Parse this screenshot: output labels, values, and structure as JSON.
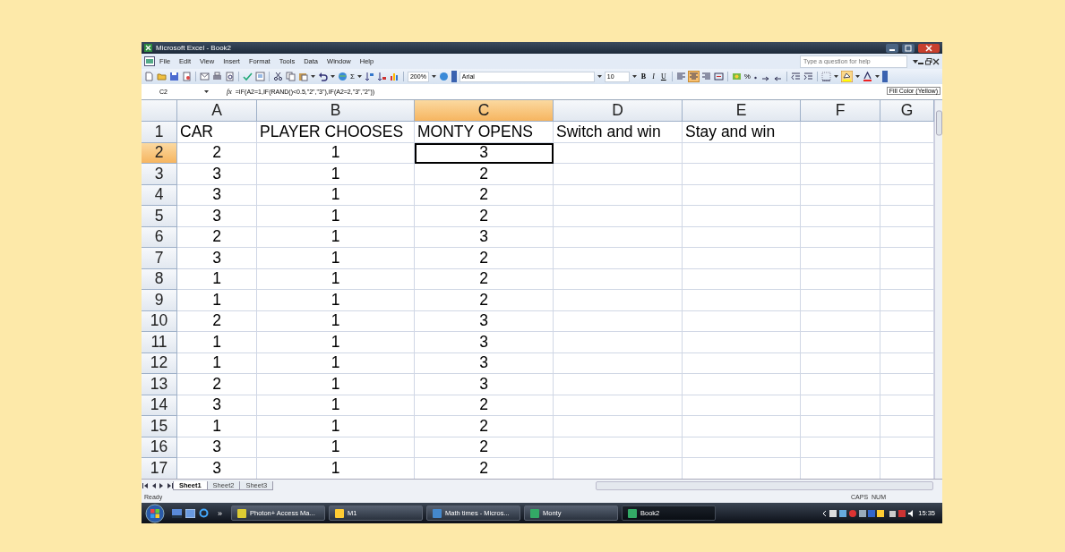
{
  "window": {
    "title": "Microsoft Excel - Book2"
  },
  "menu": {
    "items": [
      "File",
      "Edit",
      "View",
      "Insert",
      "Format",
      "Tools",
      "Data",
      "Window",
      "Help"
    ],
    "help_search": {
      "placeholder": "Type a question for help"
    }
  },
  "toolbar": {
    "sigma": "Σ",
    "zoom": "200%",
    "font": "Arial",
    "font_size": "10",
    "format_buttons": [
      {
        "label": "B",
        "kind": "bold"
      },
      {
        "label": "I",
        "kind": "italic"
      },
      {
        "label": "U",
        "kind": "underline"
      }
    ],
    "percent": "%",
    "tooltip": "Fill Color (Yellow)"
  },
  "formula_bar": {
    "name_box": "C2",
    "fx": "fx",
    "formula": "=IF(A2=1,IF(RAND()<0.5,\"2\",\"3\"),IF(A2=2,\"3\",\"2\"))"
  },
  "sheet": {
    "columns": [
      {
        "label": "A",
        "selected": false
      },
      {
        "label": "B",
        "selected": false
      },
      {
        "label": "C",
        "selected": true
      },
      {
        "label": "D",
        "selected": false
      },
      {
        "label": "E",
        "selected": false
      },
      {
        "label": "F",
        "selected": false
      },
      {
        "label": "G",
        "selected": false
      }
    ],
    "rows": [
      {
        "number": "1",
        "kind": "header",
        "selected": false,
        "cells": [
          {
            "text": "CAR",
            "selected": false
          },
          {
            "text": "PLAYER CHOOSES",
            "selected": false
          },
          {
            "text": "MONTY OPENS",
            "selected": false
          },
          {
            "text": "Switch and win",
            "selected": false
          },
          {
            "text": "Stay and win",
            "selected": false
          }
        ]
      },
      {
        "number": "2",
        "kind": "data",
        "selected": true,
        "cells": [
          {
            "text": "2",
            "selected": false
          },
          {
            "text": "1",
            "selected": false
          },
          {
            "text": "3",
            "selected": true
          }
        ]
      },
      {
        "number": "3",
        "kind": "data",
        "selected": false,
        "cells": [
          {
            "text": "3",
            "selected": false
          },
          {
            "text": "1",
            "selected": false
          },
          {
            "text": "2",
            "selected": false
          }
        ]
      },
      {
        "number": "4",
        "kind": "data",
        "selected": false,
        "cells": [
          {
            "text": "3",
            "selected": false
          },
          {
            "text": "1",
            "selected": false
          },
          {
            "text": "2",
            "selected": false
          }
        ]
      },
      {
        "number": "5",
        "kind": "data",
        "selected": false,
        "cells": [
          {
            "text": "3",
            "selected": false
          },
          {
            "text": "1",
            "selected": false
          },
          {
            "text": "2",
            "selected": false
          }
        ]
      },
      {
        "number": "6",
        "kind": "data",
        "selected": false,
        "cells": [
          {
            "text": "2",
            "selected": false
          },
          {
            "text": "1",
            "selected": false
          },
          {
            "text": "3",
            "selected": false
          }
        ]
      },
      {
        "number": "7",
        "kind": "data",
        "selected": false,
        "cells": [
          {
            "text": "3",
            "selected": false
          },
          {
            "text": "1",
            "selected": false
          },
          {
            "text": "2",
            "selected": false
          }
        ]
      },
      {
        "number": "8",
        "kind": "data",
        "selected": false,
        "cells": [
          {
            "text": "1",
            "selected": false
          },
          {
            "text": "1",
            "selected": false
          },
          {
            "text": "2",
            "selected": false
          }
        ]
      },
      {
        "number": "9",
        "kind": "data",
        "selected": false,
        "cells": [
          {
            "text": "1",
            "selected": false
          },
          {
            "text": "1",
            "selected": false
          },
          {
            "text": "2",
            "selected": false
          }
        ]
      },
      {
        "number": "10",
        "kind": "data",
        "selected": false,
        "cells": [
          {
            "text": "2",
            "selected": false
          },
          {
            "text": "1",
            "selected": false
          },
          {
            "text": "3",
            "selected": false
          }
        ]
      },
      {
        "number": "11",
        "kind": "data",
        "selected": false,
        "cells": [
          {
            "text": "1",
            "selected": false
          },
          {
            "text": "1",
            "selected": false
          },
          {
            "text": "3",
            "selected": false
          }
        ]
      },
      {
        "number": "12",
        "kind": "data",
        "selected": false,
        "cells": [
          {
            "text": "1",
            "selected": false
          },
          {
            "text": "1",
            "selected": false
          },
          {
            "text": "3",
            "selected": false
          }
        ]
      },
      {
        "number": "13",
        "kind": "data",
        "selected": false,
        "cells": [
          {
            "text": "2",
            "selected": false
          },
          {
            "text": "1",
            "selected": false
          },
          {
            "text": "3",
            "selected": false
          }
        ]
      },
      {
        "number": "14",
        "kind": "data",
        "selected": false,
        "cells": [
          {
            "text": "3",
            "selected": false
          },
          {
            "text": "1",
            "selected": false
          },
          {
            "text": "2",
            "selected": false
          }
        ]
      },
      {
        "number": "15",
        "kind": "data",
        "selected": false,
        "cells": [
          {
            "text": "1",
            "selected": false
          },
          {
            "text": "1",
            "selected": false
          },
          {
            "text": "2",
            "selected": false
          }
        ]
      },
      {
        "number": "16",
        "kind": "data",
        "selected": false,
        "cells": [
          {
            "text": "3",
            "selected": false
          },
          {
            "text": "1",
            "selected": false
          },
          {
            "text": "2",
            "selected": false
          }
        ]
      },
      {
        "number": "17",
        "kind": "data",
        "selected": false,
        "cells": [
          {
            "text": "3",
            "selected": false
          },
          {
            "text": "1",
            "selected": false
          },
          {
            "text": "2",
            "selected": false
          }
        ]
      }
    ]
  },
  "sheet_tabs": [
    {
      "label": "Sheet1",
      "selected": true
    },
    {
      "label": "Sheet2",
      "selected": false
    },
    {
      "label": "Sheet3",
      "selected": false
    }
  ],
  "status_bar": {
    "status": "Ready",
    "indicators": [
      "CAPS",
      "NUM"
    ]
  },
  "taskbar": {
    "overflow": "»",
    "buttons": [
      {
        "label": "Photon+ Access Ma...",
        "selected": false
      },
      {
        "label": "M1",
        "selected": false
      },
      {
        "label": "Math times - Micros...",
        "selected": false
      },
      {
        "label": "Monty",
        "selected": false
      },
      {
        "label": "Book2",
        "selected": true
      }
    ],
    "clock": "15:35"
  }
}
